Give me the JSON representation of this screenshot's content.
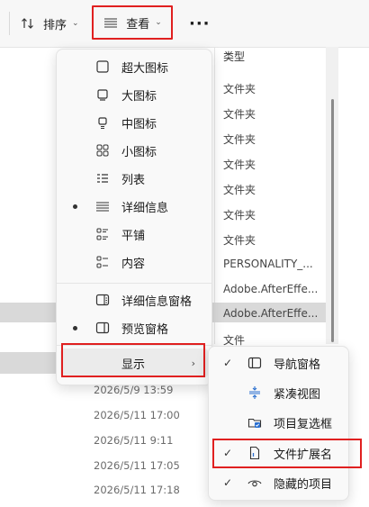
{
  "toolbar": {
    "sort_label": "排序",
    "view_label": "查看",
    "more_label": "···"
  },
  "file_list": {
    "column_type": "类型",
    "types": [
      "文件夹",
      "文件夹",
      "文件夹",
      "文件夹",
      "文件夹",
      "文件夹",
      "文件夹",
      "PERSONALITY_...",
      "Adobe.AfterEffe...",
      "Adobe.AfterEffe...",
      "文件"
    ],
    "dates": [
      "2026/5/9 13:59",
      "2026/5/11 17:00",
      "2026/5/11 9:11",
      "2026/5/11 17:05",
      "2026/5/11 17:18"
    ]
  },
  "view_menu": {
    "items": [
      {
        "label": "超大图标",
        "icon": "extra-large-icons-icon"
      },
      {
        "label": "大图标",
        "icon": "large-icons-icon"
      },
      {
        "label": "中图标",
        "icon": "medium-icons-icon"
      },
      {
        "label": "小图标",
        "icon": "small-icons-icon"
      },
      {
        "label": "列表",
        "icon": "list-icon"
      },
      {
        "label": "详细信息",
        "icon": "details-icon",
        "selected": true
      },
      {
        "label": "平铺",
        "icon": "tiles-icon"
      },
      {
        "label": "内容",
        "icon": "content-icon"
      }
    ],
    "panes": [
      {
        "label": "详细信息窗格",
        "icon": "details-pane-icon"
      },
      {
        "label": "预览窗格",
        "icon": "preview-pane-icon",
        "selected": true
      }
    ],
    "show_label": "显示"
  },
  "show_submenu": {
    "items": [
      {
        "label": "导航窗格",
        "icon": "navigation-pane-icon",
        "checked": true
      },
      {
        "label": "紧凑视图",
        "icon": "compact-view-icon",
        "checked": false
      },
      {
        "label": "项目复选框",
        "icon": "item-checkbox-icon",
        "checked": false
      },
      {
        "label": "文件扩展名",
        "icon": "file-extension-icon",
        "checked": true
      },
      {
        "label": "隐藏的项目",
        "icon": "hidden-items-icon",
        "checked": true
      }
    ]
  },
  "colors": {
    "highlight_border": "#e02020",
    "menu_bg": "#f9f9f9"
  }
}
